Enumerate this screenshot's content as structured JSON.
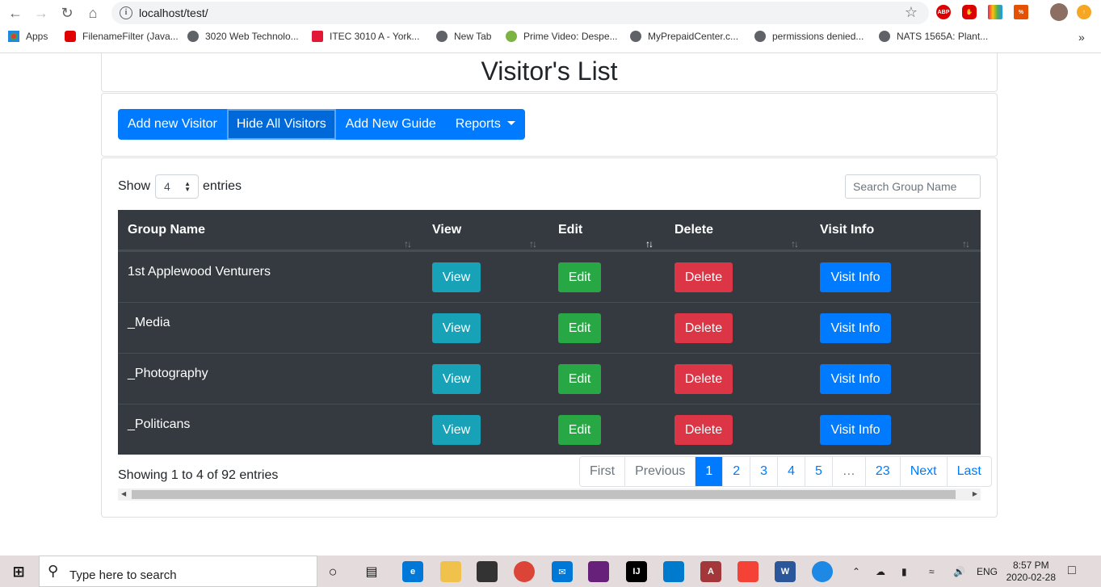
{
  "browser": {
    "url": "localhost/test/",
    "bookmarks": [
      {
        "label": "Apps",
        "color": "#4285f4"
      },
      {
        "label": "FilenameFilter (Java...",
        "color": "#e00000"
      },
      {
        "label": "3020 Web Technolo...",
        "color": "#5f6368"
      },
      {
        "label": "ITEC 3010 A - York...",
        "color": "#e31837"
      },
      {
        "label": "New Tab",
        "color": "#5f6368"
      },
      {
        "label": "Prime Video: Despe...",
        "color": "#7cb342"
      },
      {
        "label": "MyPrepaidCenter.c...",
        "color": "#5f6368"
      },
      {
        "label": "permissions denied...",
        "color": "#5f6368"
      },
      {
        "label": "NATS 1565A: Plant...",
        "color": "#5f6368"
      }
    ],
    "more": "»"
  },
  "page": {
    "title": "Visitor's List",
    "toolbar": {
      "add_visitor": "Add new Visitor",
      "hide_visitors": "Hide All Visitors",
      "add_guide": "Add New Guide",
      "reports": "Reports"
    },
    "length": {
      "show": "Show",
      "value": "4",
      "entries": "entries"
    },
    "search_placeholder": "Search Group Name",
    "columns": [
      "Group Name",
      "View",
      "Edit",
      "Delete",
      "Visit Info"
    ],
    "rows": [
      {
        "name": "1st Applewood Venturers",
        "view": "View",
        "edit": "Edit",
        "delete": "Delete",
        "visit": "Visit Info"
      },
      {
        "name": "_Media",
        "view": "View",
        "edit": "Edit",
        "delete": "Delete",
        "visit": "Visit Info"
      },
      {
        "name": "_Photography",
        "view": "View",
        "edit": "Edit",
        "delete": "Delete",
        "visit": "Visit Info"
      },
      {
        "name": "_Politicans",
        "view": "View",
        "edit": "Edit",
        "delete": "Delete",
        "visit": "Visit Info"
      }
    ],
    "info": "Showing 1 to 4 of 92 entries",
    "pagination": {
      "first": "First",
      "previous": "Previous",
      "pages": [
        "1",
        "2",
        "3",
        "4",
        "5",
        "…",
        "23"
      ],
      "next": "Next",
      "last": "Last"
    },
    "colors": {
      "primary": "#007bff",
      "info": "#17a2b8",
      "success": "#28a745",
      "danger": "#dc3545",
      "dark": "#343a40"
    }
  },
  "taskbar": {
    "search_text": "Type here to search",
    "lang": "ENG",
    "time": "8:57 PM",
    "date": "2020-02-28"
  }
}
